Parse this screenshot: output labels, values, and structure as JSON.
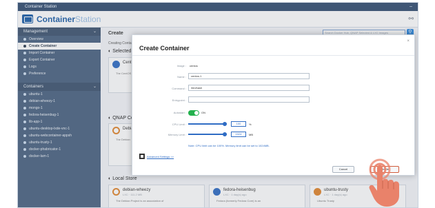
{
  "window": {
    "title": "Container Station"
  },
  "app": {
    "name_dark": "Container",
    "name_light": "Station"
  },
  "sidebar": {
    "management_label": "Management",
    "management_items": [
      {
        "label": "Overview"
      },
      {
        "label": "Create Container",
        "active": true
      },
      {
        "label": "Import Container"
      },
      {
        "label": "Export Container"
      },
      {
        "label": "Logs"
      },
      {
        "label": "Preference"
      }
    ],
    "containers_label": "Containers",
    "container_items": [
      {
        "label": "ubuntu-1"
      },
      {
        "label": "debian-wheezy-1"
      },
      {
        "label": "mongo-1"
      },
      {
        "label": "fedora-heisenbug-1"
      },
      {
        "label": "lib-app-1"
      },
      {
        "label": "ubuntu-desktop-lxde-vnc-1"
      },
      {
        "label": "ubuntu-webcontainer-appsh"
      },
      {
        "label": "ubuntu-trusty-1"
      },
      {
        "label": "docker-phabricator-1"
      },
      {
        "label": "docker-lam-1"
      }
    ]
  },
  "main": {
    "title": "Create",
    "subtitle": "Creating Container fr",
    "search_placeholder": "Search Docker Hub, QNAP Selected & LXC Images",
    "sections": {
      "selected": "Selected I",
      "qnap": "QNAP Cer",
      "local": "Local Store"
    },
    "cards_top": [
      {
        "name": "CentO",
        "desc": "The CentOS"
      }
    ],
    "cards_mid": [
      {
        "name": "Debia",
        "desc": "The Debian"
      }
    ],
    "cards_bottom": [
      {
        "name": "debian-wheezy",
        "meta": "LXC · 111.2 MB",
        "desc": "The Debian Project is an association of"
      },
      {
        "name": "fedora-heisenbug",
        "meta": "LXC · 1 day(s) ago",
        "desc": "Fedora (formerly Fedora Core) is an"
      },
      {
        "name": "ubuntu-trusty",
        "meta": "LXC · 1 day(s) ago",
        "desc": "Ubuntu Trusty"
      }
    ]
  },
  "dialog": {
    "title": "Create Container",
    "close": "×",
    "fields": {
      "image_label": "Image :",
      "image_value": "centos",
      "name_label": "Name :",
      "name_value": "centos-1",
      "command_label": "Command :",
      "command_value": "/bin/bash",
      "entrypoint_label": "Entrypoint :",
      "entrypoint_value": "",
      "autostart_label": "Autostart :",
      "autostart_value": "ON",
      "cpu_label": "CPU Limit :",
      "cpu_value": "100",
      "cpu_unit": "%",
      "cpu_fraction": 1.0,
      "mem_label": "Memory Limit :",
      "mem_value": "1024",
      "mem_unit": "MB",
      "mem_fraction": 1.0
    },
    "note": "Note: CPU limit can be 100%. Memory limit can be set to 1024MB.",
    "advanced": "Advanced Settings >>",
    "cancel": "Cancel",
    "create": "Create"
  }
}
